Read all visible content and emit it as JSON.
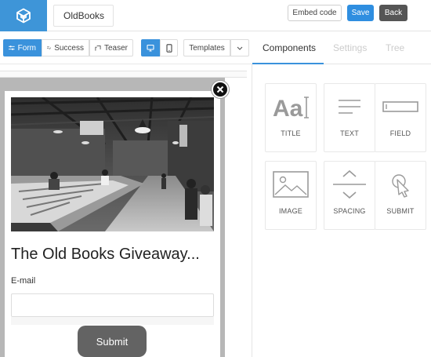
{
  "header": {
    "project_name": "OldBooks",
    "embed_label": "Embed code",
    "save_label": "Save",
    "back_label": "Back"
  },
  "toolbar": {
    "form": "Form",
    "success": "Success",
    "teaser": "Teaser",
    "templates": "Templates"
  },
  "form_preview": {
    "title": "The Old Books Giveaway...",
    "email_label": "E-mail",
    "email_value": "",
    "submit_label": "Submit"
  },
  "panel": {
    "tabs": [
      "Components",
      "Settings",
      "Tree"
    ],
    "active_tab": "Components",
    "components": [
      {
        "label": "TITLE",
        "icon": "title-icon"
      },
      {
        "label": "TEXT",
        "icon": "text-icon"
      },
      {
        "label": "FIELD",
        "icon": "field-icon"
      },
      {
        "label": "IMAGE",
        "icon": "image-icon"
      },
      {
        "label": "SPACING",
        "icon": "spacing-icon"
      },
      {
        "label": "SUBMIT",
        "icon": "submit-icon"
      }
    ]
  },
  "colors": {
    "accent": "#3a92dc",
    "back_button": "#555555",
    "submit_button": "#636363"
  }
}
